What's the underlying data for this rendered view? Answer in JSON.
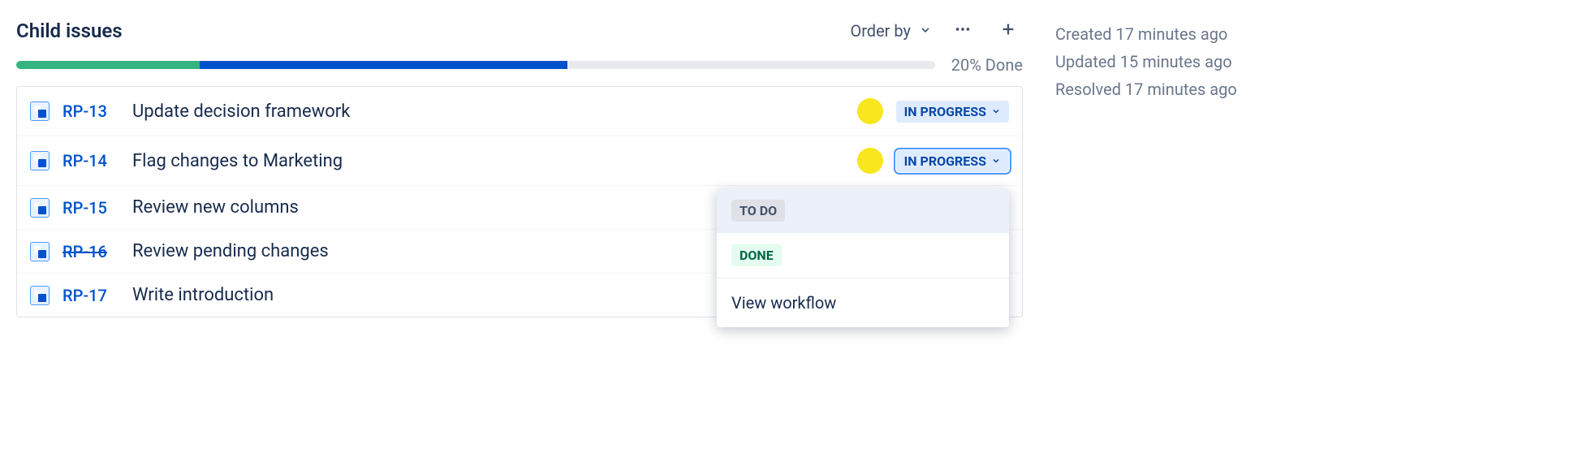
{
  "header": {
    "title": "Child issues",
    "order_by_label": "Order by"
  },
  "progress": {
    "done_percent": 20,
    "inprogress_percent": 40,
    "label": "20% Done"
  },
  "issues": [
    {
      "key": "RP-13",
      "summary": "Update decision framework",
      "assignee_color": "#F8E71C",
      "status": "IN PROGRESS",
      "status_type": "inprogress",
      "resolved": false,
      "show_avatar": true,
      "dropdown_open": false
    },
    {
      "key": "RP-14",
      "summary": "Flag changes to Marketing",
      "assignee_color": "#F8E71C",
      "status": "IN PROGRESS",
      "status_type": "inprogress",
      "resolved": false,
      "show_avatar": true,
      "dropdown_open": true
    },
    {
      "key": "RP-15",
      "summary": "Review new columns",
      "status": null,
      "resolved": false,
      "show_avatar": false,
      "dropdown_open": false
    },
    {
      "key": "RP-16",
      "summary": "Review pending changes",
      "status": null,
      "resolved": true,
      "show_avatar": false,
      "dropdown_open": false
    },
    {
      "key": "RP-17",
      "summary": "Write introduction",
      "status": null,
      "resolved": false,
      "show_avatar": false,
      "dropdown_open": false
    }
  ],
  "status_dropdown": {
    "options": [
      {
        "label": "TO DO",
        "type": "todo",
        "highlighted": true
      },
      {
        "label": "DONE",
        "type": "done",
        "highlighted": false
      }
    ],
    "footer_link": "View workflow"
  },
  "meta": {
    "created": "Created 17 minutes ago",
    "updated": "Updated 15 minutes ago",
    "resolved": "Resolved 17 minutes ago"
  }
}
